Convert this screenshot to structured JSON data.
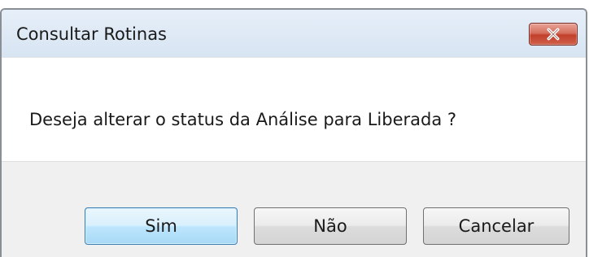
{
  "window": {
    "title": "Consultar Rotinas",
    "close_icon": "close-x-icon"
  },
  "message": {
    "text": "Deseja alterar o status da Análise para Liberada ?"
  },
  "buttons": {
    "yes_label": "Sim",
    "no_label": "Não",
    "cancel_label": "Cancelar"
  },
  "colors": {
    "titlebar": "#dce8f5",
    "close_button": "#c94a36",
    "default_button": "#bee6fd",
    "button_panel": "#f0f0f0"
  }
}
